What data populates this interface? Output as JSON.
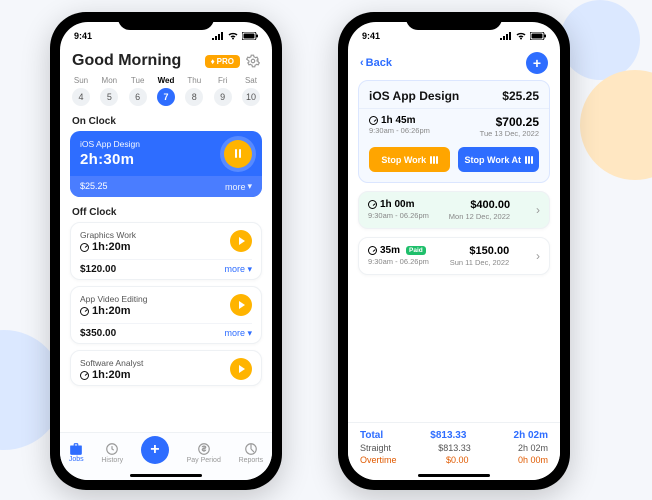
{
  "status_time": "9:41",
  "phone1": {
    "greeting": "Good Morning",
    "pro_label": "PRO",
    "days": [
      {
        "dow": "Sun",
        "num": "4"
      },
      {
        "dow": "Mon",
        "num": "5"
      },
      {
        "dow": "Tue",
        "num": "6"
      },
      {
        "dow": "Wed",
        "num": "7"
      },
      {
        "dow": "Thu",
        "num": "8"
      },
      {
        "dow": "Fri",
        "num": "9"
      },
      {
        "dow": "Sat",
        "num": "10"
      }
    ],
    "active_day_index": 3,
    "on_clock_header": "On Clock",
    "on_clock": {
      "title": "iOS App Design",
      "time": "2h:30m",
      "amount": "$25.25",
      "more": "more"
    },
    "off_clock_header": "Off Clock",
    "off_clock": [
      {
        "title": "Graphics Work",
        "time": "1h:20m",
        "amount": "$120.00",
        "more": "more"
      },
      {
        "title": "App Video Editing",
        "time": "1h:20m",
        "amount": "$350.00",
        "more": "more"
      },
      {
        "title": "Software Analyst",
        "time": "1h:20m",
        "amount": "",
        "more": ""
      }
    ],
    "tabs": {
      "jobs": "Jobs",
      "history": "History",
      "payperiod": "Pay Period",
      "reports": "Reports"
    }
  },
  "phone2": {
    "back_label": "Back",
    "project": {
      "name": "iOS App Design",
      "rate": "$25.25",
      "duration": "1h 45m",
      "earnings": "$700.25",
      "time_range": "9:30am - 06:26pm",
      "date": "Tue 13 Dec, 2022",
      "stop": "Stop Work",
      "stop_at": "Stop Work At"
    },
    "entries": [
      {
        "dur": "1h 00m",
        "range": "9:30am - 06.26pm",
        "amt": "$400.00",
        "date": "Mon 12 Dec, 2022",
        "paid": false
      },
      {
        "dur": "35m",
        "range": "9:30am - 06.26pm",
        "amt": "$150.00",
        "date": "Sun 11 Dec, 2022",
        "paid": true
      }
    ],
    "paid_label": "Paid",
    "totals": {
      "label": "Total",
      "amount": "$813.33",
      "time": "2h 02m"
    },
    "straight": {
      "label": "Straight",
      "amount": "$813.33",
      "time": "2h 02m"
    },
    "overtime": {
      "label": "Overtime",
      "amount": "$0.00",
      "time": "0h 00m"
    }
  }
}
